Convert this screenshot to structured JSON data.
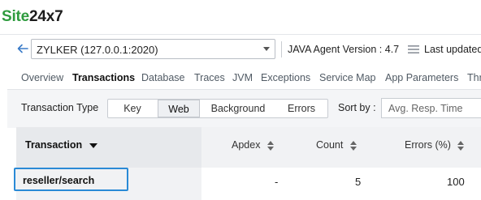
{
  "app": {
    "logo_part1": "Site",
    "logo_part2": "24x7"
  },
  "monitor": {
    "selected": "ZYLKER (127.0.0.1:2020)",
    "agent_version": "JAVA Agent Version : 4.7",
    "last_updated": "Last updated"
  },
  "tabs": [
    {
      "label": "Overview",
      "active": false
    },
    {
      "label": "Transactions",
      "active": true
    },
    {
      "label": "Database",
      "active": false
    },
    {
      "label": "Traces",
      "active": false
    },
    {
      "label": "JVM",
      "active": false
    },
    {
      "label": "Exceptions",
      "active": false
    },
    {
      "label": "Service Map",
      "active": false
    },
    {
      "label": "App Parameters",
      "active": false
    },
    {
      "label": "Thr",
      "active": false
    }
  ],
  "filter": {
    "label": "Transaction Type",
    "options": [
      {
        "label": "Key",
        "selected": false
      },
      {
        "label": "Web",
        "selected": true
      },
      {
        "label": "Background",
        "selected": false
      },
      {
        "label": "Errors",
        "selected": false
      }
    ],
    "sort_label": "Sort by :",
    "sort_value": "Avg. Resp. Time"
  },
  "table": {
    "columns": [
      "Transaction",
      "Apdex",
      "Count",
      "Errors (%)"
    ],
    "rows": [
      {
        "transaction": "reseller/search",
        "apdex": "-",
        "count": "5",
        "errors": "100"
      }
    ]
  },
  "colors": {
    "accent_blue": "#2a8ad6",
    "logo_green": "#2e9b3e"
  }
}
